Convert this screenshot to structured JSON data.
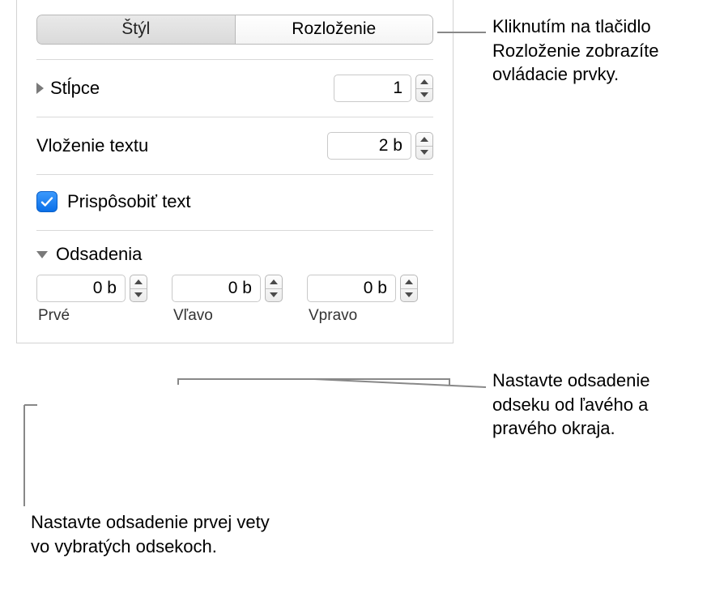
{
  "tabs": {
    "style": "Štýl",
    "layout": "Rozloženie"
  },
  "columns": {
    "label": "Stĺpce",
    "value": "1"
  },
  "text_inset": {
    "label": "Vloženie textu",
    "value": "2 b"
  },
  "shrink_text": {
    "label": "Prispôsobiť text"
  },
  "indents": {
    "header": "Odsadenia",
    "first": {
      "value": "0 b",
      "label": "Prvé"
    },
    "left": {
      "value": "0 b",
      "label": "Vľavo"
    },
    "right": {
      "value": "0 b",
      "label": "Vpravo"
    }
  },
  "callouts": {
    "layout_tab": "Kliknutím na tlačidlo Rozloženie zobrazíte ovládacie prvky.",
    "left_right": "Nastavte odsadenie odseku od ľavého a pravého okraja.",
    "first_line": "Nastavte odsadenie prvej vety vo vybratých odsekoch."
  }
}
